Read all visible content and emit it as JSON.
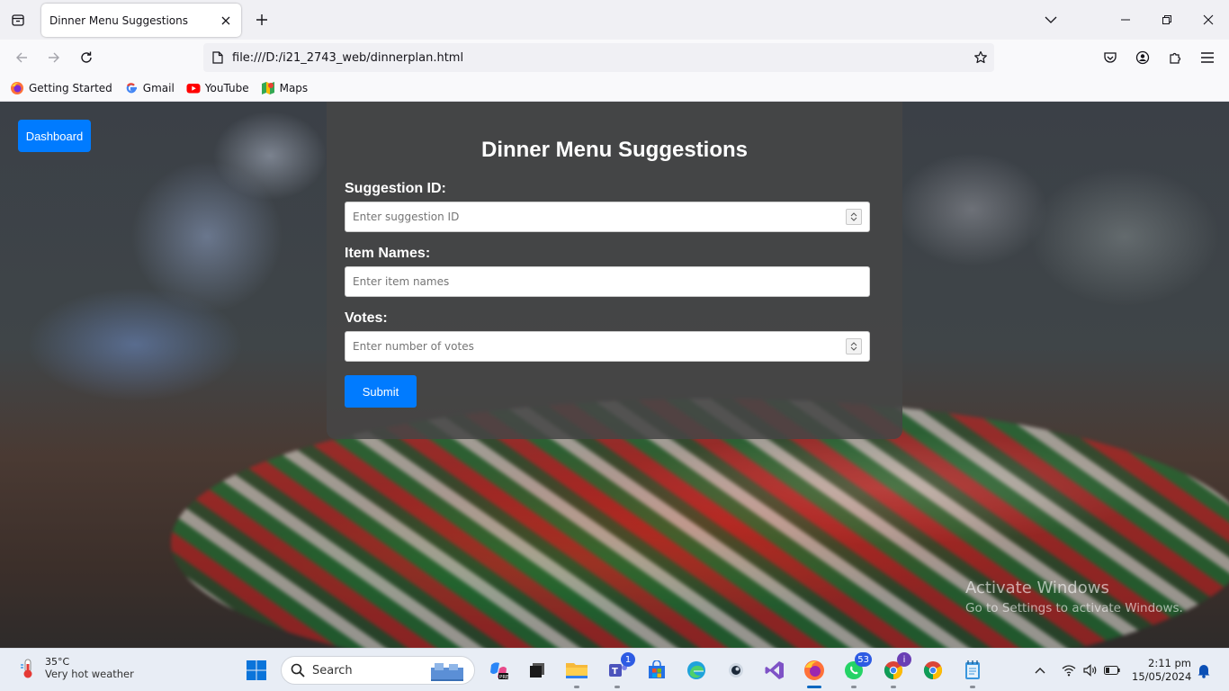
{
  "browser": {
    "tab_title": "Dinner Menu Suggestions",
    "url": "file:///D:/i21_2743_web/dinnerplan.html",
    "bookmarks": [
      {
        "label": "Getting Started",
        "icon": "firefox-icon"
      },
      {
        "label": "Gmail",
        "icon": "google-icon"
      },
      {
        "label": "YouTube",
        "icon": "youtube-icon"
      },
      {
        "label": "Maps",
        "icon": "maps-icon"
      }
    ]
  },
  "page": {
    "dashboard_label": "Dashboard",
    "form": {
      "title": "Dinner Menu Suggestions",
      "fields": [
        {
          "label": "Suggestion ID:",
          "placeholder": "Enter suggestion ID",
          "type": "number"
        },
        {
          "label": "Item Names:",
          "placeholder": "Enter item names",
          "type": "text"
        },
        {
          "label": "Votes:",
          "placeholder": "Enter number of votes",
          "type": "number"
        }
      ],
      "submit_label": "Submit"
    },
    "watermark": {
      "title": "Activate Windows",
      "subtitle": "Go to Settings to activate Windows."
    }
  },
  "taskbar": {
    "weather_temp": "35°C",
    "weather_desc": "Very hot weather",
    "search_label": "Search",
    "badges": {
      "teams": "1",
      "whatsapp": "53",
      "chrome": "i"
    },
    "time": "2:11 pm",
    "date": "15/05/2024"
  },
  "colors": {
    "accent": "#007bff",
    "card_bg": "#464646",
    "tabbar_bg": "#f0f0f4",
    "taskbar_bg": "#e8edf5"
  }
}
